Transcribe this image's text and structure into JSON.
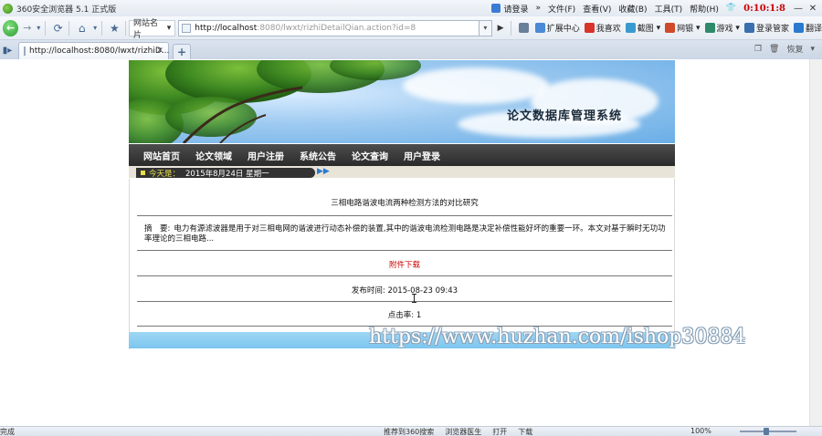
{
  "window": {
    "title": "360安全浏览器 5.1 正式版",
    "login": "请登录",
    "menu": [
      "文件(F)",
      "查看(V)",
      "收藏(B)",
      "工具(T)",
      "帮助(H)"
    ],
    "clock": "0:10:1:8"
  },
  "toolbar": {
    "bookmark_name": "网站名片",
    "address_host": "http://localhost",
    "address_rest": ":8080/lwxt/rizhiDetailQian.action?id=8",
    "tools": [
      "扩展中心",
      "我喜欢",
      "截图",
      "网银",
      "游戏",
      "登录管家",
      "翻译"
    ]
  },
  "tabs": {
    "active_tab_title": "http://localhost:8080/lwxt/rizhiD...",
    "right_restore": "恢复"
  },
  "site": {
    "title": "论文数据库管理系统",
    "nav": [
      "网站首页",
      "论文领域",
      "用户注册",
      "系统公告",
      "论文查询",
      "用户登录"
    ],
    "today_label": "今天是：",
    "today_value": "2015年8月24日 星期一"
  },
  "detail": {
    "paper_title": "三相电路谐波电流两种检测方法的对比研究",
    "abstract_label": "摘　要:",
    "abstract_text": "电力有源滤波器是用于对三相电网的谐波进行动态补偿的装置,其中的谐波电流检测电路是决定补偿性能好坏的重要一环。本文对基于瞬时无功功率理论的三相电路...",
    "attachment": "附件下载",
    "publish_label": "发布时间:",
    "publish_value": "2015-08-23 09:43",
    "clicks_label": "点击率:",
    "clicks_value": "1"
  },
  "watermark": "https://www.huzhan.com/ishop30884",
  "statusbar": {
    "left": "完成",
    "items": [
      "推荐到360搜索",
      "浏览器医生",
      "打开",
      "下载"
    ],
    "zoom": "100%"
  }
}
